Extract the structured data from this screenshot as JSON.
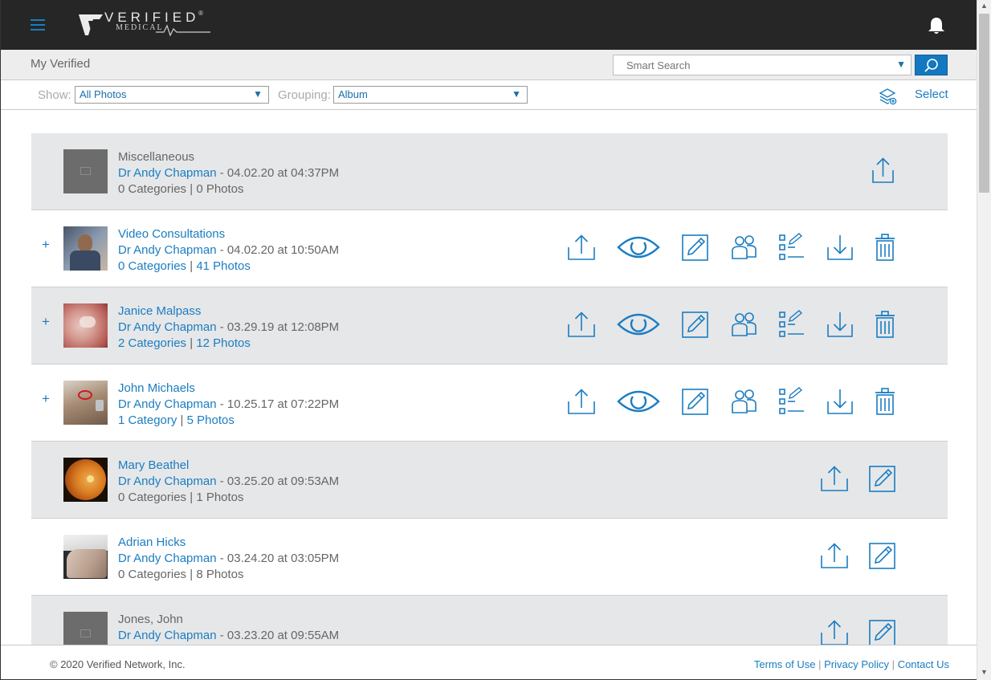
{
  "header": {
    "logo_text": "VERIFIED",
    "logo_sub": "MEDICAL",
    "logo_mark": "®"
  },
  "subheader": {
    "title": "My Verified",
    "search_placeholder": "Smart Search"
  },
  "filters": {
    "show_label": "Show:",
    "show_value": "All Photos",
    "grouping_label": "Grouping:",
    "grouping_value": "Album",
    "select_label": "Select"
  },
  "albums": [
    {
      "name": "Miscellaneous",
      "author": "Dr Andy Chapman",
      "date": " - 04.02.20 at 04:37PM",
      "categories": "0 Categories",
      "photos": "0 Photos"
    },
    {
      "name": "Video Consultations",
      "author": "Dr Andy Chapman",
      "date": " - 04.02.20 at 10:50AM",
      "categories": "0 Categories",
      "photos": "41 Photos",
      "expand": "+"
    },
    {
      "name": "Janice Malpass",
      "author": "Dr Andy Chapman",
      "date": " - 03.29.19 at 12:08PM",
      "categories": "2 Categories",
      "photos": "12 Photos",
      "expand": "+"
    },
    {
      "name": "John Michaels",
      "author": "Dr Andy Chapman",
      "date": " - 10.25.17 at 07:22PM",
      "categories": "1 Category",
      "photos": "5 Photos",
      "expand": "+"
    },
    {
      "name": "Mary Beathel",
      "author": "Dr Andy Chapman",
      "date": " - 03.25.20 at 09:53AM",
      "categories": "0 Categories",
      "photos": "1 Photos"
    },
    {
      "name": "Adrian Hicks",
      "author": "Dr Andy Chapman",
      "date": " - 03.24.20 at 03:05PM",
      "categories": "0 Categories",
      "photos": "8 Photos"
    },
    {
      "name": "Jones, John",
      "author": "Dr Andy Chapman",
      "date": " - 03.23.20 at 09:55AM",
      "categories": "",
      "photos": ""
    }
  ],
  "footer": {
    "copyright": "© 2020 Verified Network, Inc.",
    "terms": "Terms of Use",
    "privacy": "Privacy Policy",
    "contact": "Contact Us",
    "divider": "|"
  },
  "icons": {
    "menu": "hamburger-icon",
    "bell": "bell-icon",
    "search": "search-icon",
    "layers": "layers-icon",
    "upload": "upload-icon",
    "view": "eye-icon",
    "edit": "edit-icon",
    "share": "people-icon",
    "checklist": "checklist-icon",
    "download": "download-icon",
    "delete": "trash-icon"
  },
  "colors": {
    "brand_blue": "#1a7dc1",
    "topbar": "#262626",
    "row_gray": "#e6e7e9"
  }
}
